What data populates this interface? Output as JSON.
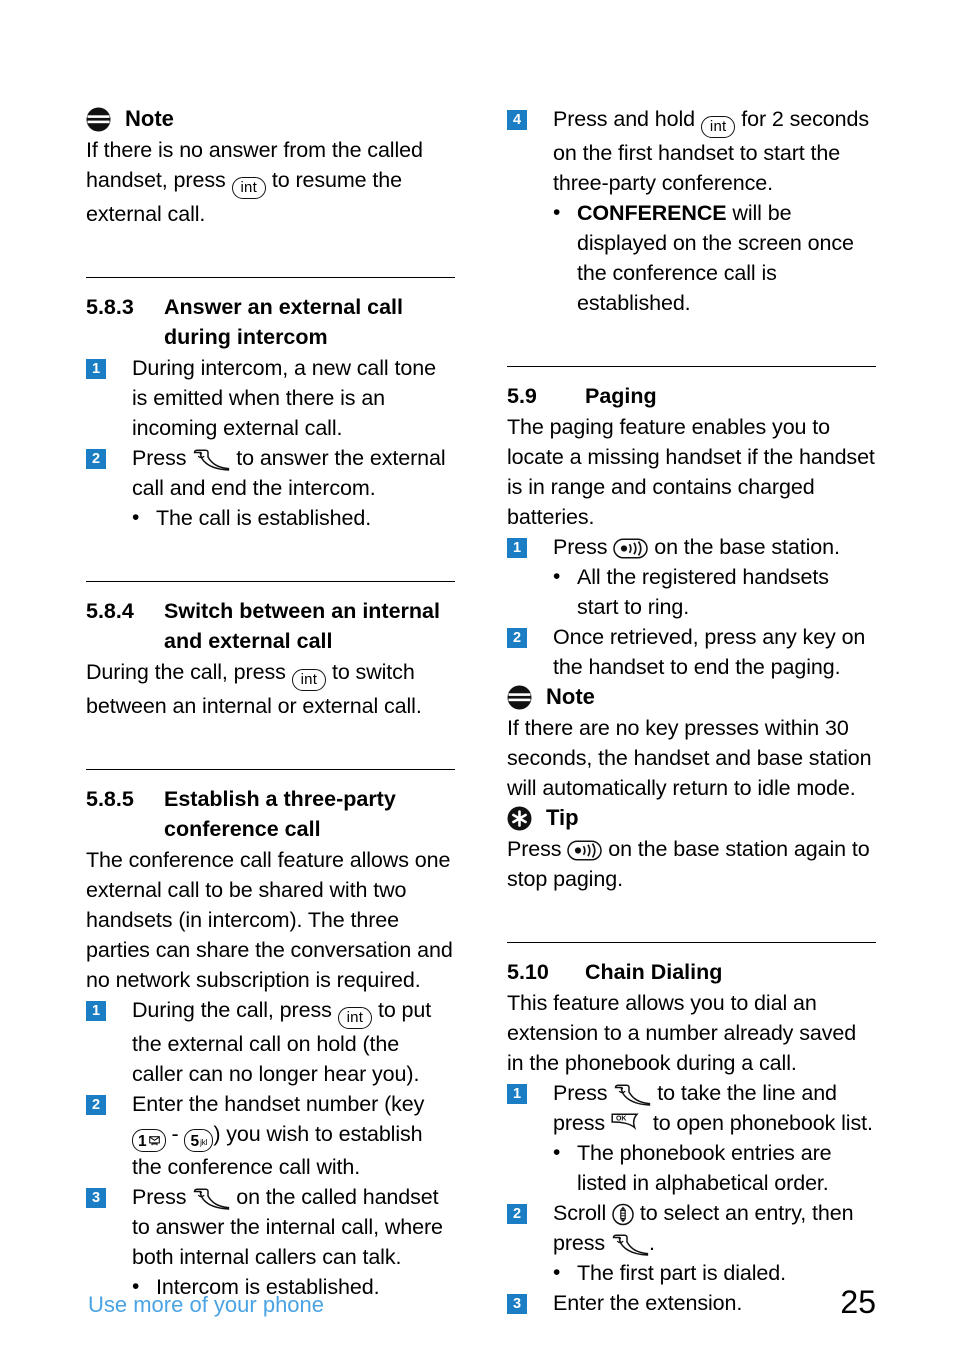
{
  "document": {
    "footer_label": "Use more of your phone",
    "page_number": "25",
    "accent_blue": "#1b7ec4",
    "footer_blue": "#4aa3e3"
  },
  "icons": {
    "note": "note-icon",
    "tip": "tip-icon",
    "int_key": "int",
    "talk_key": "talk-key-icon",
    "ok_key": "OK",
    "paging_key": "paging-key-icon",
    "scroll_key": "scroll-updown-key-icon",
    "key_one_label": "1",
    "key_five_label": "5",
    "key_five_sub": "jkl"
  },
  "left_column": {
    "note": {
      "label": "Note",
      "text_a": "If there is no answer from the called handset, press ",
      "text_b": " to resume the external call."
    },
    "section_583": {
      "number": "5.8.3",
      "title": "Answer an external call during intercom",
      "steps": [
        {
          "badge": "1",
          "text": "During intercom, a new call tone is emitted when there is an incoming external call."
        },
        {
          "badge": "2",
          "text_a": "Press ",
          "text_b": " to answer the external call and end the intercom."
        }
      ],
      "bullets": [
        "The call is established."
      ]
    },
    "section_584": {
      "number": "5.8.4",
      "title": "Switch between an internal and external call",
      "para_a": "During the call, press ",
      "para_b": " to switch between an internal or external call."
    },
    "section_585": {
      "number": "5.8.5",
      "title": "Establish a three-party conference call",
      "intro": "The conference call feature allows one external call to be shared with two handsets (in intercom). The three parties can share the conversation and no network subscription is required.",
      "step1_a": "During the call, press ",
      "step1_b": " to put the external call on hold (the caller can no longer hear you).",
      "step1_badge": "1",
      "step2_a": "Enter the handset number (key ",
      "step2_mid": " - ",
      "step2_b": ") you wish to establish the conference call with.",
      "step2_badge": "2",
      "step3_a": "Press ",
      "step3_b": " on the called handset to answer the internal call, where both internal callers can talk.",
      "step3_badge": "3",
      "bullet": "Intercom is established."
    }
  },
  "right_column": {
    "step4": {
      "badge": "4",
      "text_a": "Press and hold ",
      "text_b": " for 2 seconds on the first handset to start the three-party conference.",
      "bullet_strong": "CONFERENCE",
      "bullet_rest": " will be displayed on the screen once the conference call is established."
    },
    "section_59": {
      "number": "5.9",
      "title": "Paging",
      "intro": "The paging feature enables you to locate a missing handset if the handset is in range and contains charged batteries.",
      "step1_badge": "1",
      "step1_a": "Press ",
      "step1_b": " on the base station.",
      "step1_bullet": "All the registered handsets start to ring.",
      "step2_badge": "2",
      "step2_text": "Once retrieved, press any key on the handset to end the paging."
    },
    "note": {
      "label": "Note",
      "text": "If there are no key presses within 30 seconds, the handset and base station will automatically return to idle mode."
    },
    "tip": {
      "label": "Tip",
      "text_a": "Press ",
      "text_b": " on the base station again to stop paging."
    },
    "section_510": {
      "number": "5.10",
      "title": "Chain Dialing",
      "intro": "This feature allows you to dial an extension to a number already saved in the phonebook during a call.",
      "step1_badge": "1",
      "step1_a": "Press ",
      "step1_mid": " to take the line and press ",
      "step1_b": " to open phonebook list.",
      "step1_bullet": "The phonebook entries are listed in alphabetical order.",
      "step2_badge": "2",
      "step2_a": "Scroll ",
      "step2_mid": " to select an entry, then press ",
      "step2_b": ".",
      "step2_bullet": "The first part is dialed.",
      "step3_badge": "3",
      "step3_text": "Enter the extension."
    }
  }
}
